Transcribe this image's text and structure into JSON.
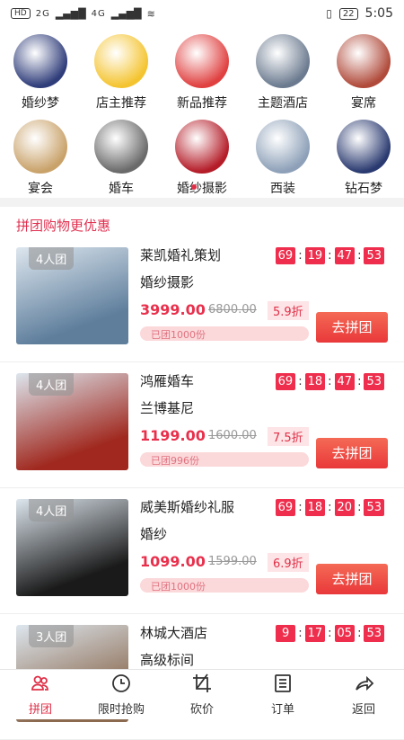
{
  "status_bar": {
    "left_chip": "HD",
    "net1": "2G",
    "net2": "4G",
    "battery": "22",
    "time": "5:05"
  },
  "categories": [
    {
      "label": "婚纱梦",
      "color": "#2f3d7a"
    },
    {
      "label": "店主推荐",
      "color": "#f4c430"
    },
    {
      "label": "新品推荐",
      "color": "#e04040"
    },
    {
      "label": "主题酒店",
      "color": "#6b7a8f"
    },
    {
      "label": "宴席",
      "color": "#b04a3a"
    },
    {
      "label": "宴会",
      "color": "#c9a26a"
    },
    {
      "label": "婚车",
      "color": "#6a6a6a"
    },
    {
      "label": "婚纱摄影",
      "color": "#b41c28"
    },
    {
      "label": "西装",
      "color": "#8da0b8"
    },
    {
      "label": "钻石梦",
      "color": "#2a3a70"
    }
  ],
  "section_title": "拼团购物更优惠",
  "deals": [
    {
      "badge": "4人团",
      "name1": "莱凯婚礼策划",
      "name2": "婚纱摄影",
      "timer": [
        "69",
        "19",
        "47",
        "53"
      ],
      "price": "3999.00",
      "orig": "6800.00",
      "discount": "5.9折",
      "sold": "已团1000份",
      "button": "去拼团",
      "thumb_color": "#5e7e9c"
    },
    {
      "badge": "4人团",
      "name1": "鸿雁婚车",
      "name2": "兰博基尼",
      "timer": [
        "69",
        "18",
        "47",
        "53"
      ],
      "price": "1199.00",
      "orig": "1600.00",
      "discount": "7.5折",
      "sold": "已团996份",
      "button": "去拼团",
      "thumb_color": "#a0281e"
    },
    {
      "badge": "4人团",
      "name1": "威美斯婚纱礼服",
      "name2": "婚纱",
      "timer": [
        "69",
        "18",
        "20",
        "53"
      ],
      "price": "1099.00",
      "orig": "1599.00",
      "discount": "6.9折",
      "sold": "已团1000份",
      "button": "去拼团",
      "thumb_color": "#1a1a1a"
    },
    {
      "badge": "3人团",
      "name1": "林城大酒店",
      "name2": "高级标间",
      "timer": [
        "9",
        "17",
        "05",
        "53"
      ],
      "price": "",
      "orig": "",
      "discount": "",
      "sold": "",
      "button": "",
      "thumb_color": "#8b6a50"
    }
  ],
  "tabs": [
    {
      "label": "拼团",
      "icon": "group-icon",
      "active": true
    },
    {
      "label": "限时抢购",
      "icon": "clock-icon",
      "active": false
    },
    {
      "label": "砍价",
      "icon": "crop-icon",
      "active": false
    },
    {
      "label": "订单",
      "icon": "order-icon",
      "active": false
    },
    {
      "label": "返回",
      "icon": "back-arrow-icon",
      "active": false
    }
  ]
}
